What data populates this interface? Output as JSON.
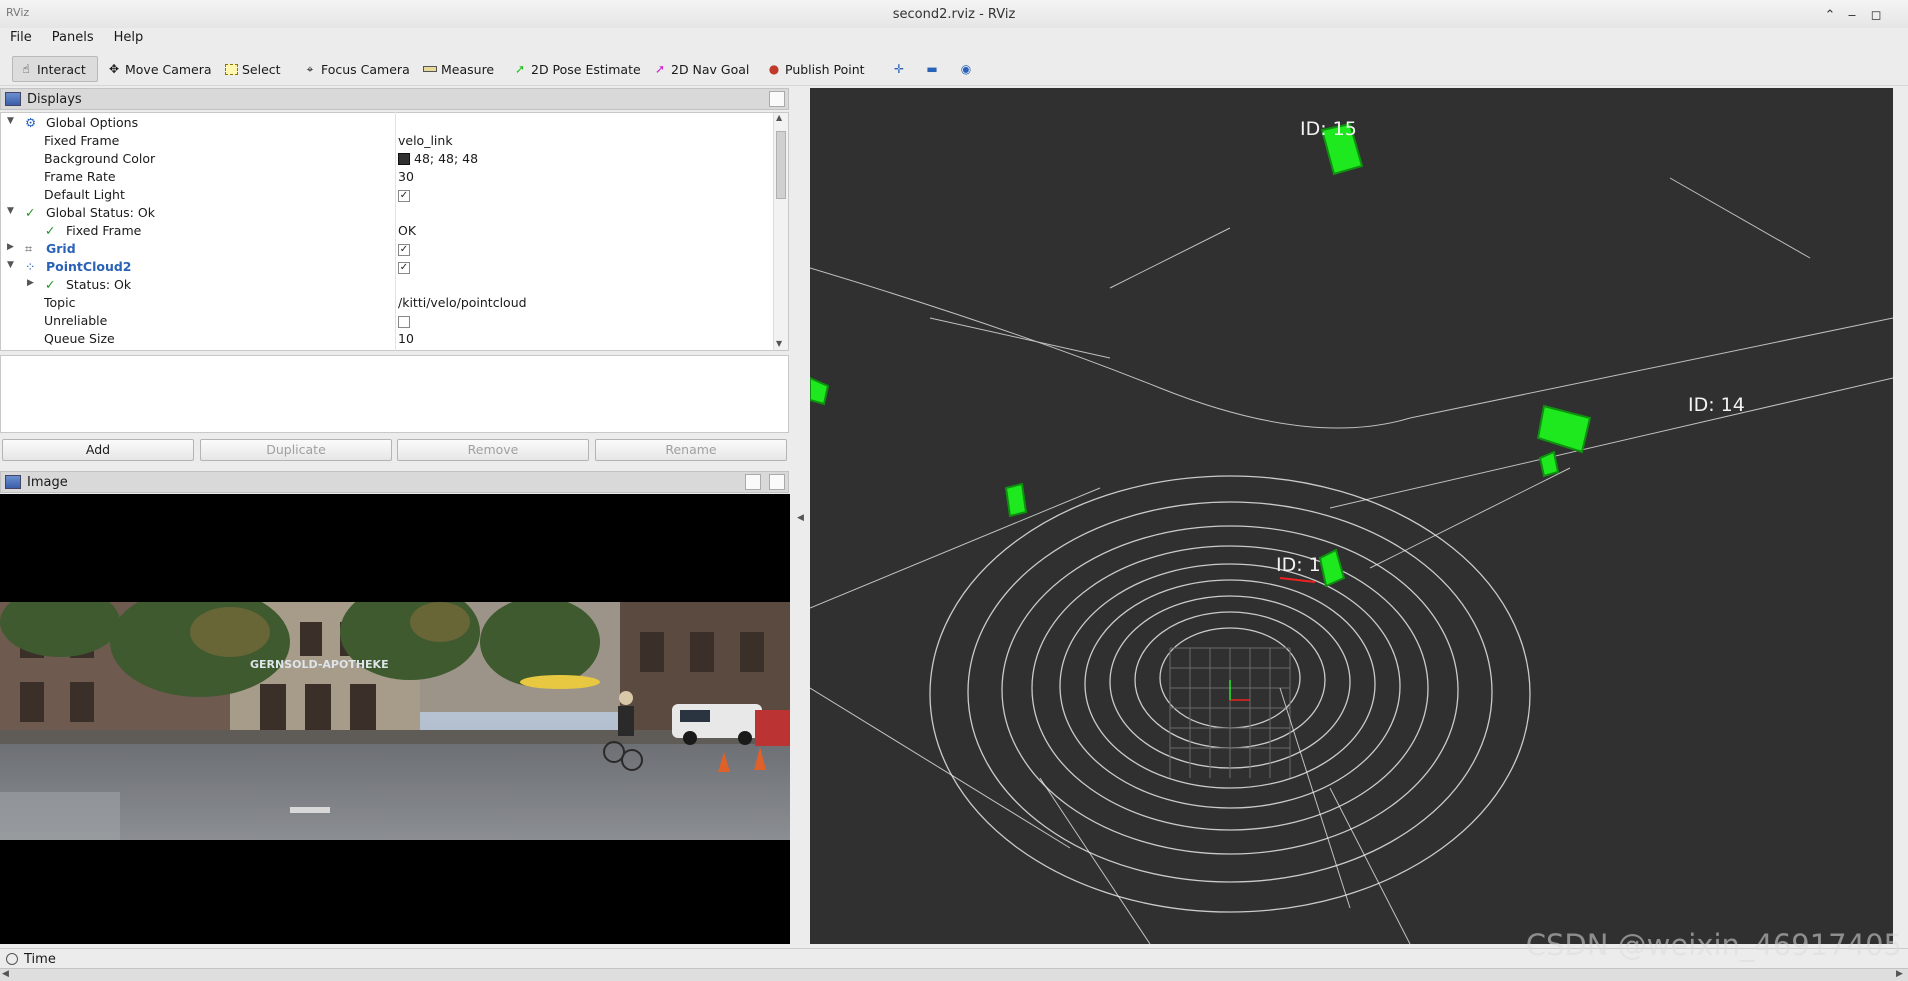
{
  "window": {
    "app_tag": "RViz",
    "title": "second2.rviz - RViz",
    "controls": [
      "⌃",
      "‒",
      "◻"
    ]
  },
  "menu": [
    "File",
    "Panels",
    "Help"
  ],
  "toolbar": {
    "interact": "Interact",
    "move_camera": "Move Camera",
    "select": "Select",
    "focus_camera": "Focus Camera",
    "measure": "Measure",
    "pose_estimate": "2D Pose Estimate",
    "nav_goal": "2D Nav Goal",
    "publish_point": "Publish Point"
  },
  "displays": {
    "header": "Displays",
    "rows": {
      "global_options": "Global Options",
      "fixed_frame_k": "Fixed Frame",
      "fixed_frame_v": "velo_link",
      "bg_color_k": "Background Color",
      "bg_color_v": "48; 48; 48",
      "frame_rate_k": "Frame Rate",
      "frame_rate_v": "30",
      "default_light_k": "Default Light",
      "global_status": "Global Status: Ok",
      "status_fixed_frame_k": "Fixed Frame",
      "status_fixed_frame_v": "OK",
      "grid": "Grid",
      "pointcloud2": "PointCloud2",
      "status_ok": "Status: Ok",
      "topic_k": "Topic",
      "topic_v": "/kitti/velo/pointcloud",
      "unreliable_k": "Unreliable",
      "queue_size_k": "Queue Size",
      "queue_size_v": "10"
    },
    "buttons": {
      "add": "Add",
      "duplicate": "Duplicate",
      "remove": "Remove",
      "rename": "Rename"
    }
  },
  "image_panel": {
    "header": "Image",
    "shop_sign": "GERNSOLD-APOTHEKE"
  },
  "viewport": {
    "background_color": "#303030",
    "labels": [
      "ID: 15",
      "ID: 14",
      "ID: 1"
    ]
  },
  "time_panel": {
    "header": "Time"
  },
  "watermark": "CSDN @weixin_46917405"
}
